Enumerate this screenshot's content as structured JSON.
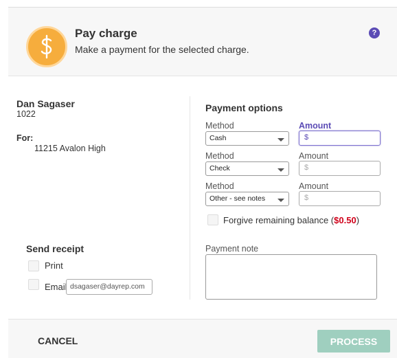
{
  "header": {
    "title": "Pay charge",
    "subtitle": "Make a payment for the selected charge.",
    "help_symbol": "?",
    "icon": "dollar-coin-icon",
    "colors": {
      "coin": "#f6ad3d",
      "help": "#5b4bb5"
    }
  },
  "customer": {
    "name": "Dan Sagaser",
    "id": "1022",
    "for_label": "For:",
    "for_value": "11215 Avalon High"
  },
  "payment_options": {
    "title": "Payment options",
    "rows": [
      {
        "method_label": "Method",
        "method_value": "Cash",
        "amount_label": "Amount",
        "amount_value": "$"
      },
      {
        "method_label": "Method",
        "method_value": "Check",
        "amount_label": "Amount",
        "amount_value": "$"
      },
      {
        "method_label": "Method",
        "method_value": "Other - see notes",
        "amount_label": "Amount",
        "amount_value": "$"
      }
    ],
    "forgive_text": "Forgive remaining balance (",
    "forgive_amount": "$0.50",
    "forgive_close": ")"
  },
  "receipt": {
    "title": "Send receipt",
    "print_label": "Print",
    "email_label": "Email",
    "email_value": "dsagaser@dayrep.com"
  },
  "note": {
    "label": "Payment note",
    "value": ""
  },
  "footer": {
    "cancel_label": "CANCEL",
    "process_label": "PROCESS",
    "colors": {
      "process_bg": "#9fcfbf"
    }
  }
}
